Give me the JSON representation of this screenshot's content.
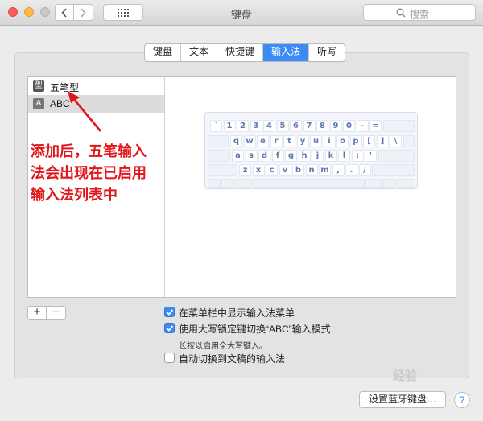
{
  "window": {
    "title": "键盘",
    "search_placeholder": "搜索"
  },
  "tabs": [
    {
      "label": "键盘",
      "active": false
    },
    {
      "label": "文本",
      "active": false
    },
    {
      "label": "快捷键",
      "active": false
    },
    {
      "label": "输入法",
      "active": true
    },
    {
      "label": "听写",
      "active": false
    }
  ],
  "input_sources": [
    {
      "icon_char": "型",
      "label": "五笔型",
      "selected": false
    },
    {
      "icon_char": "A",
      "label": "ABC",
      "selected": true
    }
  ],
  "keyboard_rows": [
    [
      "`",
      "1",
      "2",
      "3",
      "4",
      "5",
      "6",
      "7",
      "8",
      "9",
      "0",
      "-",
      "="
    ],
    [
      "q",
      "w",
      "e",
      "r",
      "t",
      "y",
      "u",
      "i",
      "o",
      "p",
      "[",
      "]",
      "\\"
    ],
    [
      "a",
      "s",
      "d",
      "f",
      "g",
      "h",
      "j",
      "k",
      "l",
      ";",
      "'"
    ],
    [
      "z",
      "x",
      "c",
      "v",
      "b",
      "n",
      "m",
      ",",
      ".",
      "/"
    ]
  ],
  "list_buttons": {
    "add": "+",
    "remove": "−"
  },
  "options": {
    "show_in_menu_bar": {
      "label": "在菜单栏中显示输入法菜单",
      "checked": true
    },
    "caps_lock_switch": {
      "label": "使用大写锁定键切换“ABC”输入模式",
      "checked": true
    },
    "caps_lock_hint": "长按以启用全大写键入。",
    "auto_switch": {
      "label": "自动切换到文稿的输入法",
      "checked": false
    }
  },
  "bottom": {
    "bluetooth_button": "设置蓝牙键盘…",
    "help": "?"
  },
  "annotation": {
    "lines": [
      "添加后，五笔输入",
      "法会出现在已启用",
      "输入法列表中"
    ],
    "color": "#e0161b"
  },
  "watermark": "经验",
  "colors": {
    "accent": "#3a8cf4",
    "key_text": "#5c79b0"
  }
}
